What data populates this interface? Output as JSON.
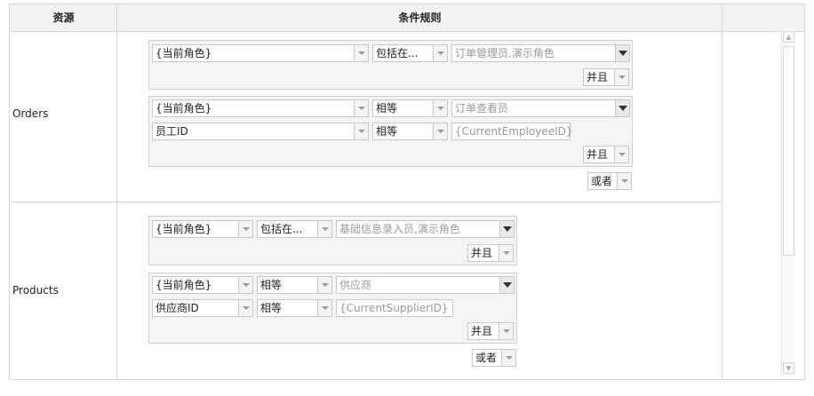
{
  "header": {
    "col_resource": "资源",
    "col_rules": "条件规则"
  },
  "rows": [
    {
      "resource": "Orders",
      "groups": [
        {
          "conditions": [
            {
              "field": "{当前角色}",
              "operator": "包括在...",
              "value": "订单管理员,演示角色"
            }
          ],
          "logic": "并且"
        },
        {
          "conditions": [
            {
              "field": "{当前角色}",
              "operator": "相等",
              "value": "订单查看员"
            },
            {
              "field": "员工ID",
              "operator": "相等",
              "value": "{CurrentEmployeeID}"
            }
          ],
          "logic": "并且"
        }
      ],
      "outer_logic": "或者"
    },
    {
      "resource": "Products",
      "groups": [
        {
          "conditions": [
            {
              "field": "{当前角色}",
              "operator": "包括在...",
              "value": "基础信息录入员,演示角色"
            }
          ],
          "logic": "并且"
        },
        {
          "conditions": [
            {
              "field": "{当前角色}",
              "operator": "相等",
              "value": "供应商"
            },
            {
              "field": "供应商ID",
              "operator": "相等",
              "value": "{CurrentSupplierID}"
            }
          ],
          "logic": "并且"
        }
      ],
      "outer_logic": "或者"
    }
  ]
}
